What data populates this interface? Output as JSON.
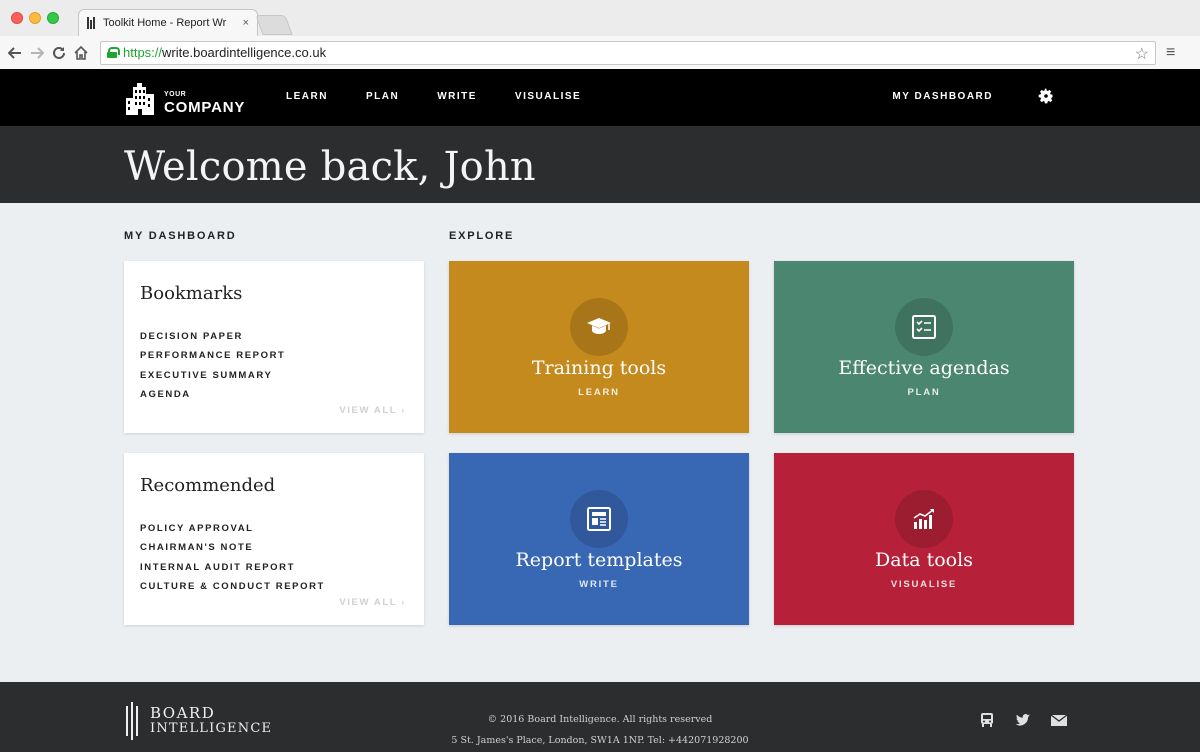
{
  "browser": {
    "tab_title": "Toolkit Home - Report Wr",
    "tab_close": "×",
    "url_protocol": "https://",
    "url_rest": "write.boardintelligence.co.uk"
  },
  "header": {
    "logo_small": "YOUR",
    "logo_large": "COMPANY",
    "nav": [
      "LEARN",
      "PLAN",
      "WRITE",
      "VISUALISE"
    ],
    "right_link": "MY DASHBOARD"
  },
  "hero": {
    "title": "Welcome back, John"
  },
  "dashboard": {
    "label": "MY DASHBOARD",
    "bookmarks": {
      "title": "Bookmarks",
      "items": [
        "DECISION PAPER",
        "PERFORMANCE REPORT",
        "EXECUTIVE SUMMARY",
        "AGENDA"
      ],
      "view_all": "VIEW ALL ›"
    },
    "recommended": {
      "title": "Recommended",
      "items": [
        "POLICY APPROVAL",
        "CHAIRMAN'S NOTE",
        "INTERNAL AUDIT REPORT",
        "CULTURE & CONDUCT REPORT"
      ],
      "view_all": "VIEW ALL ›"
    }
  },
  "explore": {
    "label": "EXPLORE",
    "tiles": [
      {
        "title": "Training tools",
        "subtitle": "LEARN",
        "color": "#c48a1e",
        "icon": "graduation-cap-icon"
      },
      {
        "title": "Effective agendas",
        "subtitle": "PLAN",
        "color": "#4a8670",
        "icon": "checklist-icon"
      },
      {
        "title": "Report templates",
        "subtitle": "WRITE",
        "color": "#3867b4",
        "icon": "document-icon"
      },
      {
        "title": "Data tools",
        "subtitle": "VISUALISE",
        "color": "#b62139",
        "icon": "bar-chart-icon"
      }
    ]
  },
  "footer": {
    "logo_line1": "BOARD",
    "logo_line2": "INTELLIGENCE",
    "copyright": "© 2016 Board Intelligence. All rights reserved",
    "address": "5 St. James's Place, London, SW1A 1NP. Tel: +442071928200",
    "icons": [
      "bus-icon",
      "twitter-icon",
      "mail-icon"
    ]
  }
}
